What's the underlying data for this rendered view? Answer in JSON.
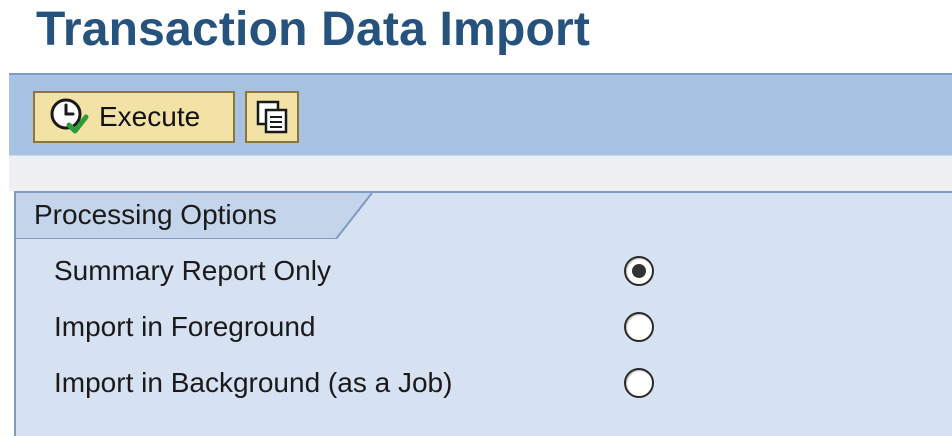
{
  "page": {
    "title": "Transaction Data Import"
  },
  "toolbar": {
    "execute_label": "Execute",
    "execute_icon": "execute-clock-check-icon",
    "variant_icon": "get-variant-icon"
  },
  "processing_options": {
    "group_title": "Processing Options",
    "options": [
      {
        "label": "Summary Report Only",
        "checked": true
      },
      {
        "label": "Import in Foreground",
        "checked": false
      },
      {
        "label": "Import in Background (as a Job)",
        "checked": false
      }
    ]
  },
  "colors": {
    "title": "#26527e",
    "toolbar_bg": "#a8c2e3",
    "button_bg": "#f2e2a6",
    "group_bg": "#d6e1f1",
    "group_tab_bg": "#c3d4eb"
  }
}
